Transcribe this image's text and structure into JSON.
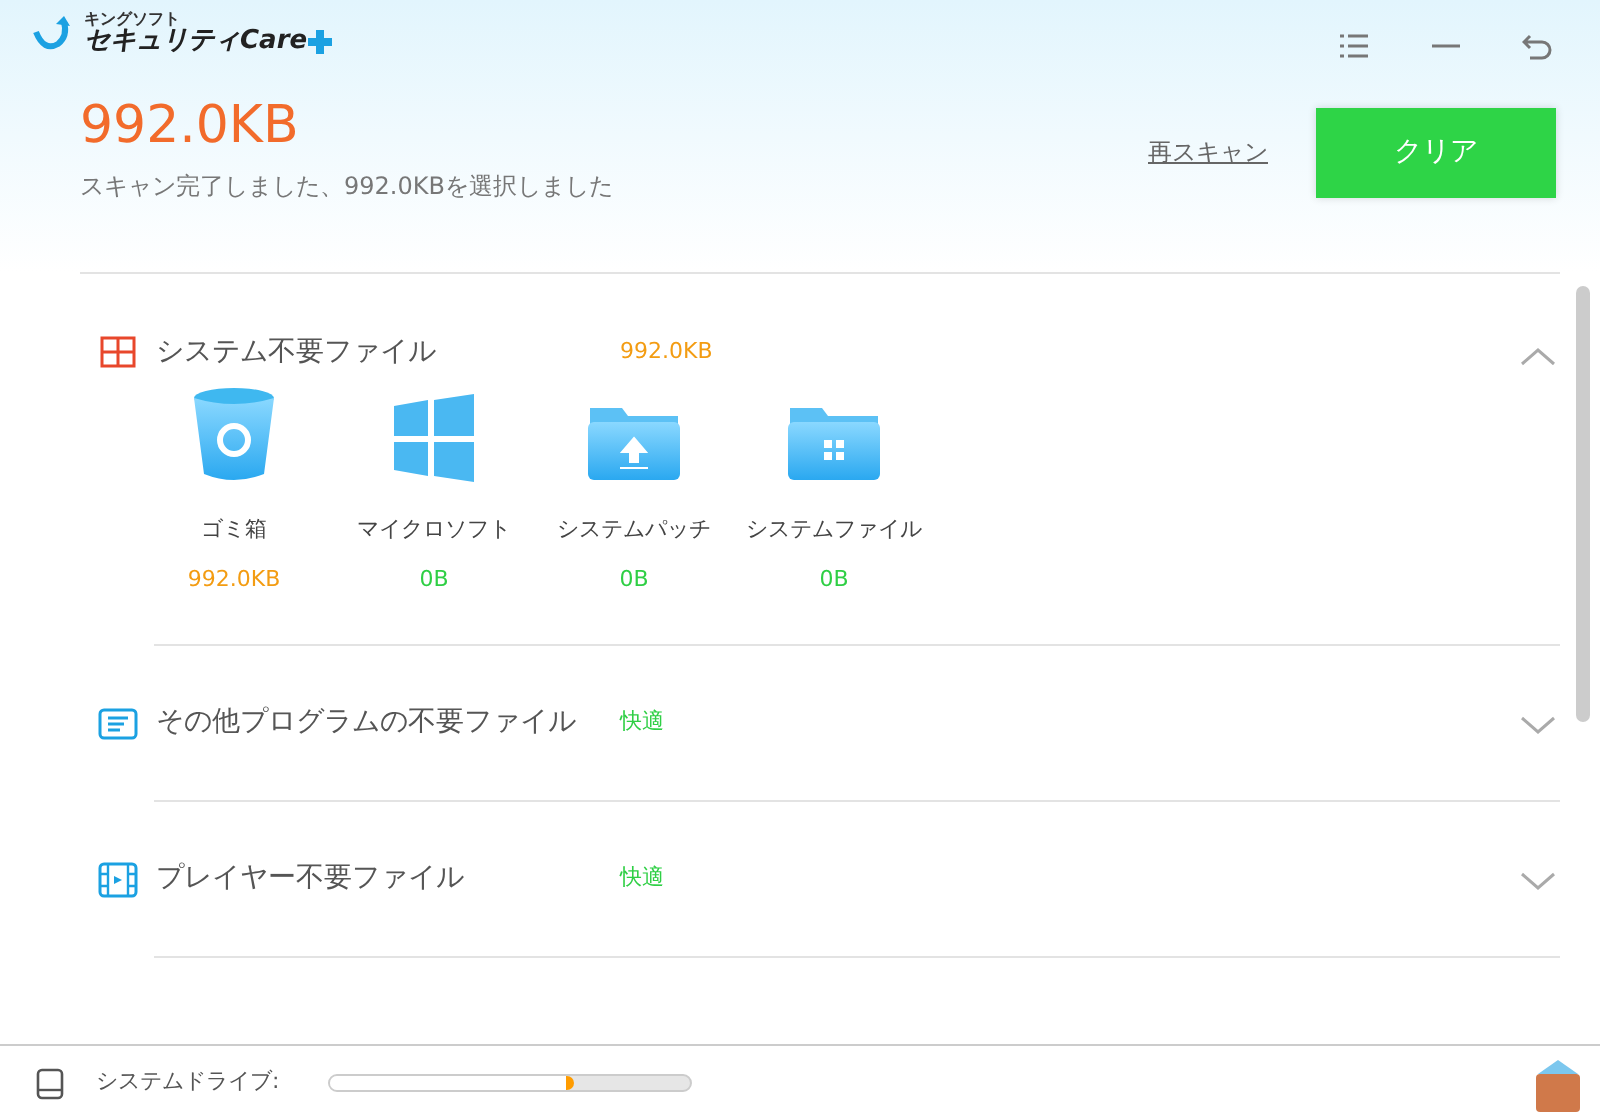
{
  "app": {
    "vendor": "キングソフト",
    "name": "セキュリティCare"
  },
  "summary": {
    "size": "992.0KB",
    "message": "スキャン完了しました、992.0KBを選択しました"
  },
  "actions": {
    "rescan": "再スキャン",
    "clean": "クリア"
  },
  "categories": [
    {
      "title": "システム不要ファイル",
      "kind": "windows",
      "status": "992.0KB",
      "color": "#f39c12",
      "expanded": true,
      "items": [
        {
          "kind": "trash",
          "name": "ゴミ箱",
          "size": "992.0KB",
          "color": "#f39c12"
        },
        {
          "kind": "windows",
          "name": "マイクロソフト",
          "size": "0B",
          "color": "#2fcf45"
        },
        {
          "kind": "patch-folder",
          "name": "システムパッチ",
          "size": "0B",
          "color": "#2fcf45"
        },
        {
          "kind": "system-folder",
          "name": "システムファイル",
          "size": "0B",
          "color": "#2fcf45"
        }
      ]
    },
    {
      "title": "その他プログラムの不要ファイル",
      "kind": "program",
      "status": "快適",
      "color": "#2fcf45",
      "expanded": false
    },
    {
      "title": "プレイヤー不要ファイル",
      "kind": "player",
      "status": "快適",
      "color": "#2fcf45",
      "expanded": false
    }
  ],
  "drive": {
    "label": "システムドライブ:",
    "level": 0.68
  }
}
